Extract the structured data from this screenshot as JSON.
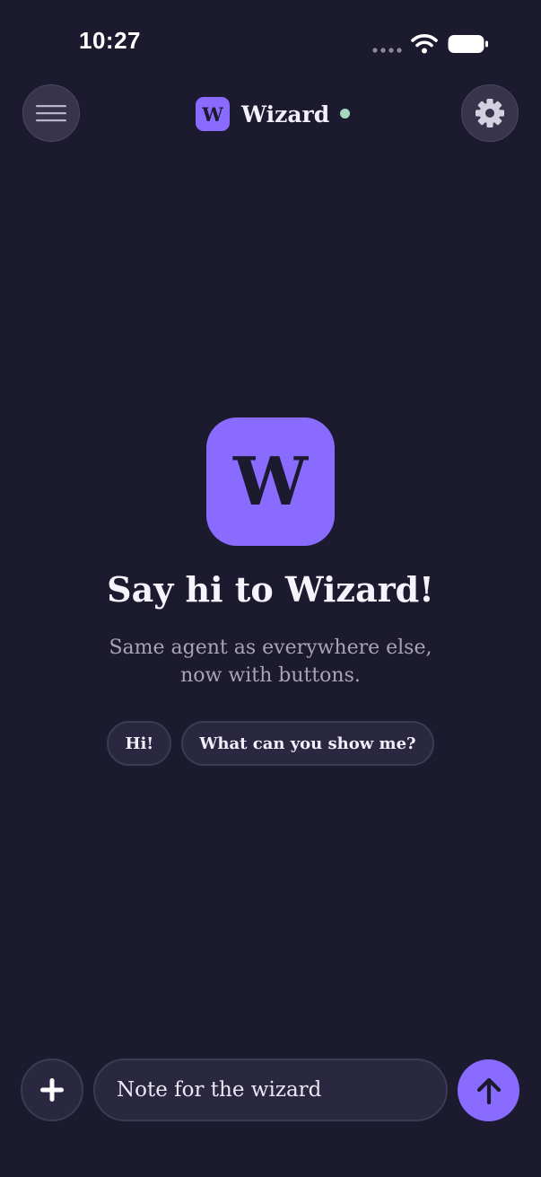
{
  "status_bar": {
    "time": "10:27",
    "icons": [
      "signal-dots-icon",
      "wifi-icon",
      "battery-icon"
    ]
  },
  "header": {
    "menu_icon": "hamburger-menu-icon",
    "logo_letter": "W",
    "title": "Wizard",
    "status": "online",
    "settings_icon": "gear-icon"
  },
  "empty_state": {
    "logo_letter": "W",
    "title": "Say hi to Wizard!",
    "subtitle_lines": [
      "Same agent as everywhere else,",
      "now with buttons."
    ],
    "suggestions": [
      "Hi!",
      "What can you show me?"
    ]
  },
  "composer": {
    "add_icon": "plus-icon",
    "placeholder": "Note for the wizard",
    "value": "",
    "send_icon": "arrow-up-icon"
  },
  "colors": {
    "background": "#1c1a2e",
    "accent": "#8a6bff",
    "online_indicator": "#a6d8bf",
    "surface": "#2a2740",
    "text_primary": "#f3f0fb",
    "text_secondary": "#a7a3b8"
  }
}
